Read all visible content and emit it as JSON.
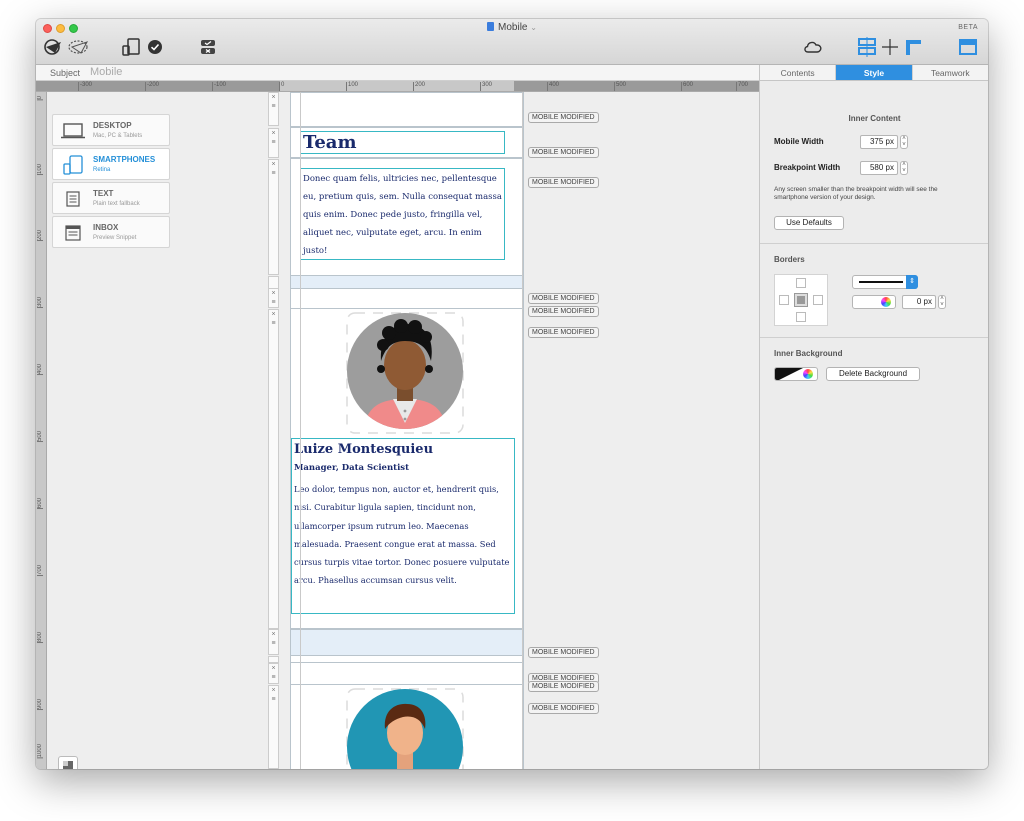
{
  "window": {
    "title": "Mobile",
    "badge": "BETA"
  },
  "subject": {
    "label": "Subject",
    "value": "Mobile"
  },
  "ruler": {
    "h_ticks": [
      "-300",
      "-200",
      "-100",
      "0",
      "100",
      "200",
      "300",
      "400",
      "500",
      "600",
      "700"
    ],
    "v_ticks": [
      "0",
      "100",
      "200",
      "300",
      "400",
      "500",
      "600",
      "700",
      "800",
      "900",
      "1000"
    ]
  },
  "devices": [
    {
      "name": "DESKTOP",
      "sub": "Mac, PC & Tablets"
    },
    {
      "name": "SMARTPHONES",
      "sub": "Retina"
    },
    {
      "name": "TEXT",
      "sub": "Plain text fallback"
    },
    {
      "name": "INBOX",
      "sub": "Preview Snippet"
    }
  ],
  "email": {
    "team_title": "Team",
    "intro": "Donec quam felis, ultricies nec, pellentesque eu, pretium quis, sem. Nulla consequat massa quis enim. Donec pede justo, fringilla vel, aliquet nec, vulputate eget, arcu. In enim justo!",
    "person_name": "Luize Montesquieu",
    "person_role": "Manager, Data Scientist",
    "person_bio": "Leo dolor, tempus non, auctor et, hendrerit quis, nisi. Curabitur ligula sapien, tincidunt non, ullamcorper ipsum rutrum leo. Maecenas malesuada. Praesent congue erat at massa. Sed cursus turpis vitae tortor. Donec posuere vulputate arcu. Phasellus accumsan cursus velit."
  },
  "modified_tag": "MOBILE MODIFIED",
  "panel": {
    "tabs": [
      "Contents",
      "Style",
      "Teamwork"
    ],
    "inner_content_title": "Inner Content",
    "mobile_width_label": "Mobile Width",
    "mobile_width_value": "375 px",
    "breakpoint_label": "Breakpoint Width",
    "breakpoint_value": "580 px",
    "help_text": "Any screen smaller than the breakpoint width will see the smartphone version of your design.",
    "use_defaults": "Use Defaults",
    "borders_title": "Borders",
    "border_px": "0 px",
    "inner_bg_title": "Inner Background",
    "delete_bg": "Delete Background"
  },
  "colors": {
    "accent": "#2f8fe0",
    "text_navy": "#1a2a6c",
    "frame_teal": "#38b8c4"
  }
}
